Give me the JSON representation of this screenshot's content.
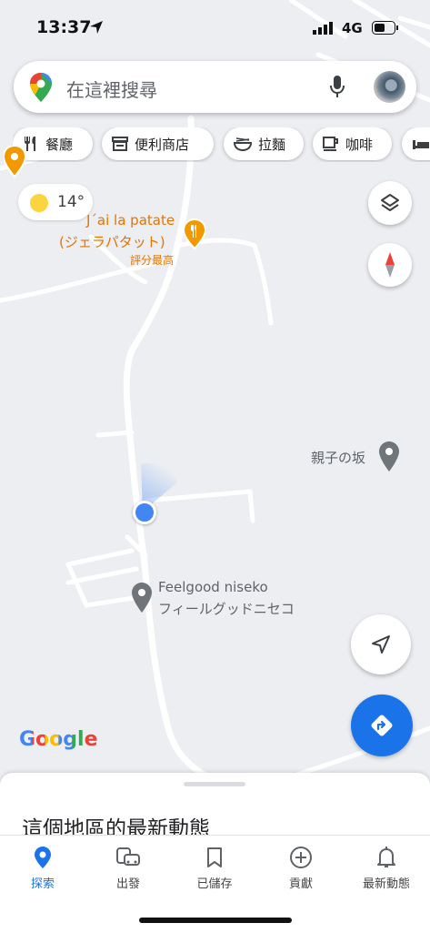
{
  "status": {
    "time": "13:37",
    "network": "4G"
  },
  "search": {
    "placeholder": "在這裡搜尋"
  },
  "chips": [
    {
      "label": "餐廳",
      "icon": "restaurant-icon"
    },
    {
      "label": "便利商店",
      "icon": "store-icon"
    },
    {
      "label": "拉麵",
      "icon": "ramen-icon"
    },
    {
      "label": "咖啡",
      "icon": "coffee-icon"
    }
  ],
  "weather": {
    "temp": "14°"
  },
  "places": {
    "jai_line1": "J´ai la patate",
    "jai_line2": "(ジェラパタット)",
    "jai_note": "評分最高",
    "oyako": "親子の坂",
    "feelgood_line1": "Feelgood niseko",
    "feelgood_line2": "フィールグッドニセコ"
  },
  "map": {
    "brand": "Google"
  },
  "sheet": {
    "title": "這個地區的最新動態"
  },
  "tabs": [
    {
      "label": "探索",
      "icon": "explore-pin-icon",
      "active": true
    },
    {
      "label": "出發",
      "icon": "commute-icon"
    },
    {
      "label": "已儲存",
      "icon": "bookmark-icon"
    },
    {
      "label": "貢獻",
      "icon": "add-circle-icon"
    },
    {
      "label": "最新動態",
      "icon": "bell-icon"
    }
  ],
  "colors": {
    "accent": "#1a73e8",
    "poi_orange": "#e37400",
    "map_bg": "#eceef2"
  }
}
